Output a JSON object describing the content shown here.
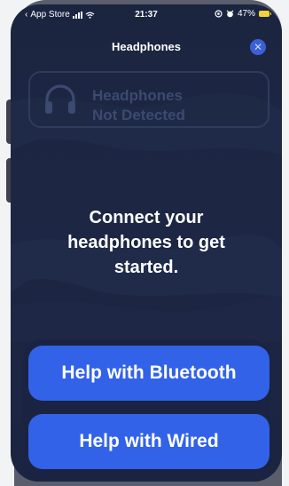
{
  "status_bar": {
    "back_app": "App Store",
    "time": "21:37",
    "battery": "47%"
  },
  "header": {
    "title": "Headphones",
    "close_glyph": "✕"
  },
  "status_card": {
    "icon": "headphones-icon",
    "line1": "Headphones",
    "line2": "Not Detected"
  },
  "message": {
    "line1": "Connect your",
    "line2": "headphones to get",
    "line3": "started."
  },
  "actions": {
    "bluetooth_label": "Help with Bluetooth",
    "wired_label": "Help with Wired"
  },
  "colors": {
    "background": "#1b2540",
    "accent": "#3262e8",
    "muted_text": "#3c4a70",
    "battery": "#f2d13a"
  }
}
